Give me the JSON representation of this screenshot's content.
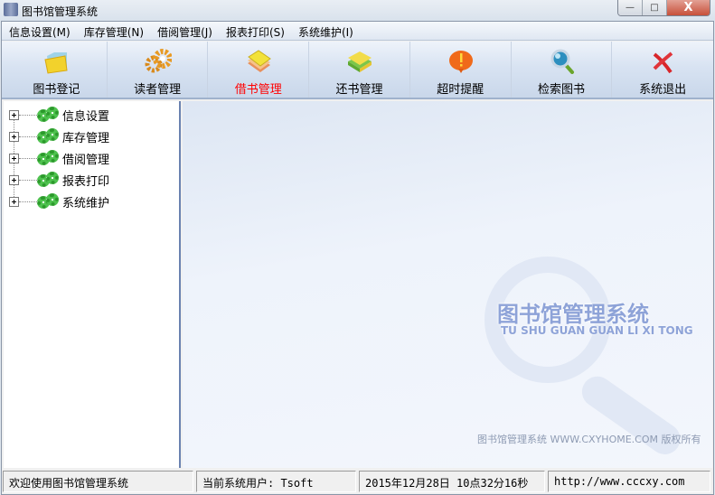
{
  "window": {
    "title": "图书馆管理系统",
    "buttons": {
      "minimize": "—",
      "maximize": "□",
      "close": "X"
    }
  },
  "menu": [
    {
      "label": "信息设置(M)"
    },
    {
      "label": "库存管理(N)"
    },
    {
      "label": "借阅管理(J)"
    },
    {
      "label": "报表打印(S)"
    },
    {
      "label": "系统维护(I)"
    }
  ],
  "toolbar": [
    {
      "label": "图书登记",
      "icon": "folder-icon"
    },
    {
      "label": "读者管理",
      "icon": "gears-icon"
    },
    {
      "label": "借书管理",
      "icon": "books-icon",
      "active": true
    },
    {
      "label": "还书管理",
      "icon": "stack-icon"
    },
    {
      "label": "超时提醒",
      "icon": "alert-icon"
    },
    {
      "label": "检索图书",
      "icon": "magnifier-icon"
    },
    {
      "label": "系统退出",
      "icon": "exit-icon"
    }
  ],
  "tree": [
    {
      "label": "信息设置"
    },
    {
      "label": "库存管理"
    },
    {
      "label": "借阅管理"
    },
    {
      "label": "报表打印"
    },
    {
      "label": "系统维护"
    }
  ],
  "main": {
    "logo_cn": "图书馆管理系统",
    "logo_en": "TU SHU GUAN GUAN LI XI TONG",
    "copyright": "图书馆管理系统  WWW.CXYHOME.COM 版权所有"
  },
  "status": {
    "welcome": "欢迎使用图书馆管理系统",
    "user": "当前系统用户: Tsoft",
    "datetime": "2015年12月28日 10点32分16秒",
    "url": "http://www.cccxy.com"
  }
}
